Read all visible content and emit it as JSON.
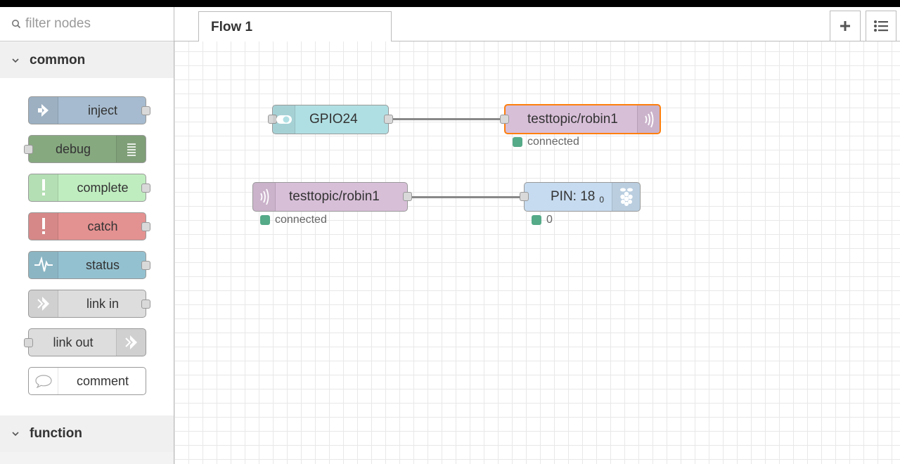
{
  "palette": {
    "filter_placeholder": "filter nodes",
    "categories": [
      {
        "label": "common"
      },
      {
        "label": "function"
      }
    ],
    "nodes": [
      {
        "label": "inject",
        "color": "#a6bbcf"
      },
      {
        "label": "debug",
        "color": "#87a980"
      },
      {
        "label": "complete",
        "color": "#c0edc0"
      },
      {
        "label": "catch",
        "color": "#e49191"
      },
      {
        "label": "status",
        "color": "#94c1d0"
      },
      {
        "label": "link in",
        "color": "#dddddd"
      },
      {
        "label": "link out",
        "color": "#dddddd"
      },
      {
        "label": "comment",
        "color": "#ffffff"
      }
    ]
  },
  "tabs": [
    {
      "label": "Flow 1"
    }
  ],
  "toolbar": {
    "add_icon": "plus-icon",
    "menu_icon": "list-icon"
  },
  "flow": {
    "nodes": [
      {
        "label": "GPIO24",
        "color": "#b0dfe3"
      },
      {
        "label": "testtopic/robin1",
        "color": "#d8bfd8",
        "status": "connected"
      },
      {
        "label": "testtopic/robin1",
        "color": "#d8bfd8",
        "status": "connected"
      },
      {
        "label": "PIN: 18",
        "sub": "0",
        "color": "#c6dbef",
        "status": "0"
      }
    ]
  }
}
